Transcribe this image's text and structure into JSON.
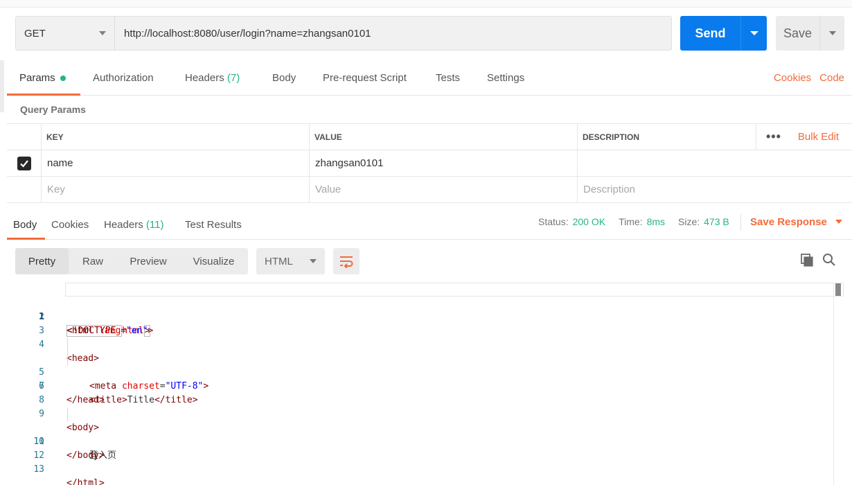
{
  "request": {
    "method": "GET",
    "url": "http://localhost:8080/user/login?name=zhangsan0101",
    "send_label": "Send",
    "save_label": "Save"
  },
  "request_tabs": [
    {
      "label": "Params",
      "active": true,
      "has_dot": true
    },
    {
      "label": "Authorization"
    },
    {
      "label": "Headers",
      "count": "(7)"
    },
    {
      "label": "Body"
    },
    {
      "label": "Pre-request Script"
    },
    {
      "label": "Tests"
    },
    {
      "label": "Settings"
    }
  ],
  "right_links": {
    "cookies": "Cookies",
    "code": "Code"
  },
  "query_params": {
    "title": "Query Params",
    "headers": {
      "key": "KEY",
      "value": "VALUE",
      "description": "DESCRIPTION",
      "bulk_edit": "Bulk Edit",
      "more": "•••"
    },
    "rows": [
      {
        "checked": true,
        "key": "name",
        "value": "zhangsan0101",
        "description": ""
      }
    ],
    "placeholders": {
      "key": "Key",
      "value": "Value",
      "description": "Description"
    }
  },
  "response_tabs": [
    {
      "label": "Body",
      "active": true
    },
    {
      "label": "Cookies"
    },
    {
      "label": "Headers",
      "count": "(11)"
    },
    {
      "label": "Test Results"
    }
  ],
  "response_status": {
    "status_label": "Status:",
    "status_value": "200 OK",
    "time_label": "Time:",
    "time_value": "8ms",
    "size_label": "Size:",
    "size_value": "473 B",
    "save_response": "Save Response"
  },
  "body_view": {
    "buttons": [
      "Pretty",
      "Raw",
      "Preview",
      "Visualize"
    ],
    "active": "Pretty",
    "language": "HTML",
    "icons": [
      "wrap-lines-icon",
      "copy-icon",
      "search-icon"
    ]
  },
  "code_lines": [
    {
      "n": "1"
    },
    {
      "n": "2"
    },
    {
      "n": "3"
    },
    {
      "n": "4"
    },
    {
      "n": "5"
    },
    {
      "n": "6"
    },
    {
      "n": "7"
    },
    {
      "n": "8"
    },
    {
      "n": "9"
    },
    {
      "n": "10"
    },
    {
      "n": "11"
    },
    {
      "n": "12"
    },
    {
      "n": "13"
    }
  ],
  "code": {
    "l1_doctype": "<!DOCTYPE ",
    "l1_html": "html",
    "l1_close": ">",
    "l2_open": "<html ",
    "l2_attr": "lang",
    "l2_eq": "=",
    "l2_val": "\"en\"",
    "l2_close": ">",
    "l4": "<head>",
    "l5_open": "<meta ",
    "l5_attr": "charset",
    "l5_eq": "=",
    "l5_val": "\"UTF-8\"",
    "l5_close": ">",
    "l6_open": "<title>",
    "l6_text": "Title",
    "l6_close": "</title>",
    "l7": "</head>",
    "l9": "<body>",
    "l10": "登入页",
    "l11": "</body>",
    "l13": "</html>"
  }
}
